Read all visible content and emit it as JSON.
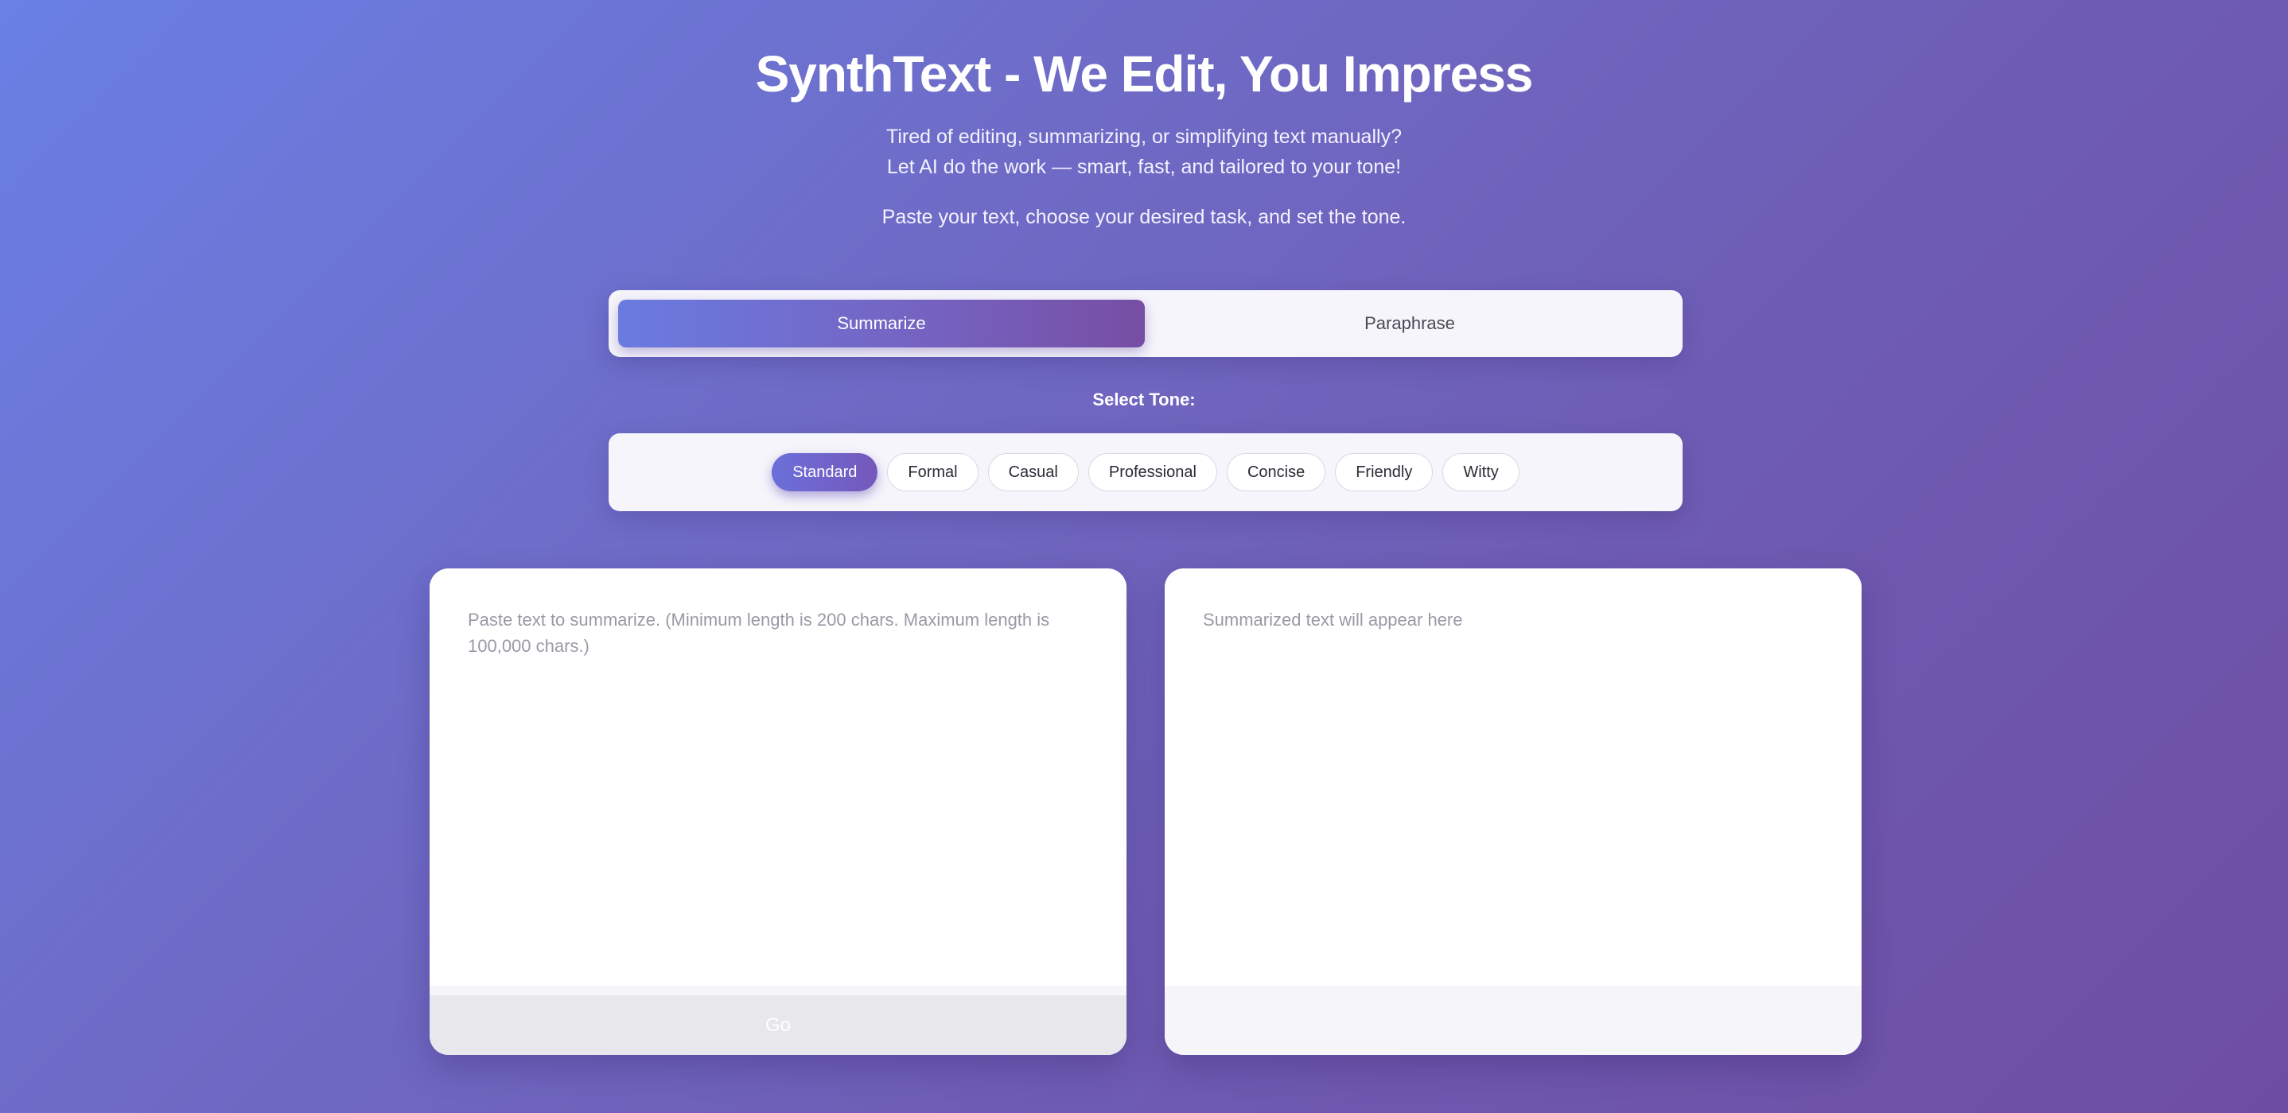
{
  "header": {
    "title": "SynthText - We Edit, You Impress",
    "subtitle_line1": "Tired of editing, summarizing, or simplifying text manually?",
    "subtitle_line2": "Let AI do the work — smart, fast, and tailored to your tone!",
    "instruction": "Paste your text, choose your desired task, and set the tone."
  },
  "tasks": {
    "selected": "Summarize",
    "items": [
      {
        "label": "Summarize",
        "active": true
      },
      {
        "label": "Paraphrase",
        "active": false
      }
    ]
  },
  "tone": {
    "label": "Select Tone:",
    "selected": "Standard",
    "options": [
      {
        "label": "Standard",
        "active": true
      },
      {
        "label": "Formal",
        "active": false
      },
      {
        "label": "Casual",
        "active": false
      },
      {
        "label": "Professional",
        "active": false
      },
      {
        "label": "Concise",
        "active": false
      },
      {
        "label": "Friendly",
        "active": false
      },
      {
        "label": "Witty",
        "active": false
      }
    ]
  },
  "input": {
    "value": "",
    "placeholder": "Paste text to summarize. (Minimum length is 200 chars. Maximum length is 100,000 chars.)",
    "go_label": "Go"
  },
  "output": {
    "value": "",
    "placeholder": "Summarized text will appear here"
  },
  "colors": {
    "gradient_start": "#6a80e5",
    "gradient_end": "#6e4ea3",
    "accent": "#7558bb"
  }
}
